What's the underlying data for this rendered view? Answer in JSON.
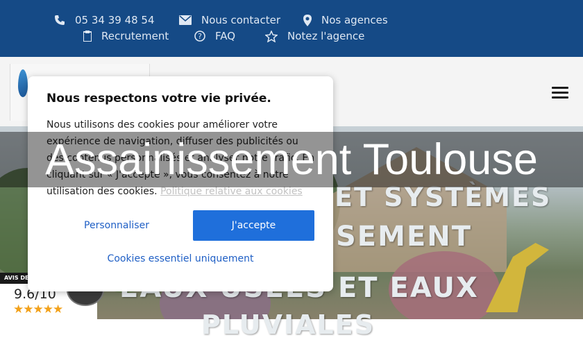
{
  "topbar": {
    "phone": "05 34 39 48 54",
    "contact": "Nous contacter",
    "agencies": "Nos agences",
    "recruitment": "Recrutement",
    "faq": "FAQ",
    "rate": "Notez l'agence"
  },
  "hero": {
    "line1": "ET SYSTÈMES",
    "line2": "SEMENT",
    "line3": "EAUX USÉES ET EAUX",
    "line4": "PLUVIALES"
  },
  "page_title": "Assainissement Toulouse",
  "cookie_modal": {
    "title": "Nous respectons votre vie privée.",
    "text": "Nous utilisons des cookies pour améliorer votre expérience de navigation, diffuser des publicités ou des contenus personnalisés et analyser notre trafic. En cliquant sur « J'accepte », vous consentez à notre utilisation des cookies.",
    "policy_link": "Politique relative aux cookies",
    "customize_label": "Personnaliser",
    "accept_label": "J'accepte",
    "essential_label": "Cookies essentiel uniquement"
  },
  "review": {
    "badge": "AVIS DE",
    "score": "9.6/10",
    "stars": "★★★★★"
  },
  "colors": {
    "topbar": "#154a86",
    "accept_button": "#1f6fdb",
    "link_blue": "#1f5fc5",
    "stars": "#f2a11a"
  }
}
